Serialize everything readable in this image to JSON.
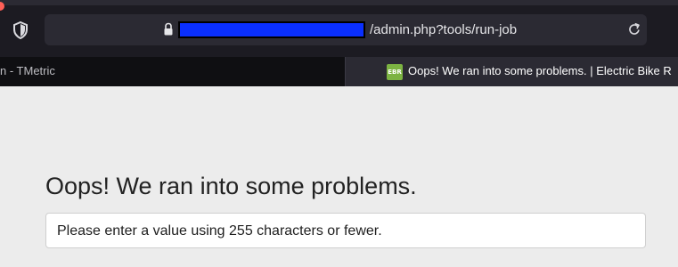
{
  "browser": {
    "address_bar": {
      "url_visible": "/admin.php?tools/run-job",
      "redaction_color": "#0a2fff"
    },
    "tabs": [
      {
        "title": "n - TMetric",
        "active": false
      },
      {
        "title": "Oops! We ran into some problems. | Electric Bike R",
        "active": true,
        "favicon_text": "EBR"
      }
    ]
  },
  "page": {
    "title": "Oops! We ran into some problems.",
    "error_message": "Please enter a value using 255 characters or fewer."
  },
  "icons": {
    "shield": "shield-icon",
    "lock": "lock-icon",
    "reload": "reload-icon"
  }
}
